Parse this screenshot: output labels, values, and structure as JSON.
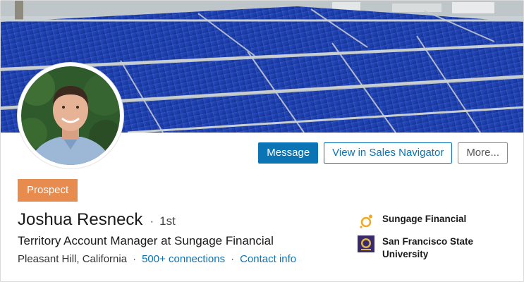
{
  "profile": {
    "name": "Joshua Resneck",
    "degree": "1st",
    "headline": "Territory Account Manager at Sungage Financial",
    "location": "Pleasant Hill, California",
    "connections": "500+ connections",
    "contact_info": "Contact info",
    "badge": "Prospect"
  },
  "actions": {
    "message": "Message",
    "sales_navigator": "View in Sales Navigator",
    "more": "More..."
  },
  "side": {
    "company": "Sungage Financial",
    "school": "San Francisco State University"
  },
  "colors": {
    "primary": "#0a74b5",
    "badge": "#e88b4e",
    "panel_blue": "#1d3fae"
  },
  "icons": {
    "company_logo": "sungage-logo-icon",
    "school_logo": "sfsu-seal-icon"
  }
}
